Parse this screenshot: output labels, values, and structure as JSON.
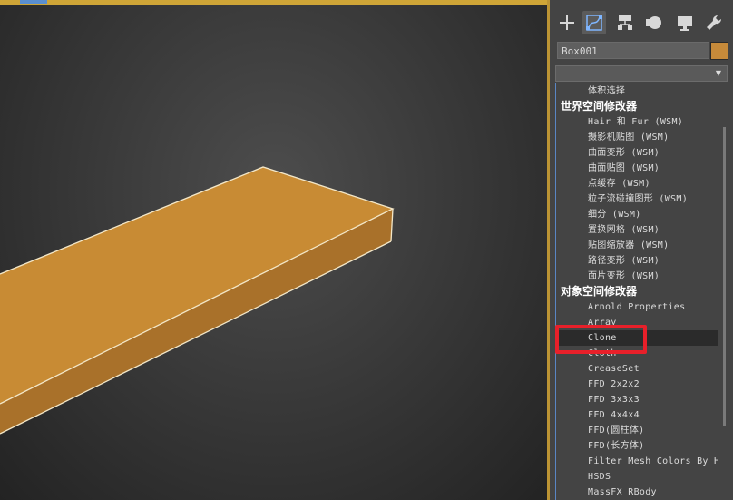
{
  "object_name": "Box001",
  "object_color": "#c68a3a",
  "modifier_dropdown_value": "",
  "command_tabs": [
    {
      "name": "create",
      "icon": "plus-icon"
    },
    {
      "name": "modify",
      "icon": "modify-curve-icon",
      "active": true
    },
    {
      "name": "hierarchy",
      "icon": "hierarchy-icon"
    },
    {
      "name": "motion",
      "icon": "motion-icon"
    },
    {
      "name": "display",
      "icon": "display-monitor-icon"
    },
    {
      "name": "utilities",
      "icon": "wrench-icon"
    }
  ],
  "modifier_list": {
    "rows": [
      {
        "type": "item",
        "label": "体积选择"
      },
      {
        "type": "header",
        "label": "世界空间修改器"
      },
      {
        "type": "item",
        "label": "Hair 和 Fur (WSM)"
      },
      {
        "type": "item",
        "label": "摄影机贴图 (WSM)"
      },
      {
        "type": "item",
        "label": "曲面变形 (WSM)"
      },
      {
        "type": "item",
        "label": "曲面贴图 (WSM)"
      },
      {
        "type": "item",
        "label": "点缓存 (WSM)"
      },
      {
        "type": "item",
        "label": "粒子流碰撞图形 (WSM)"
      },
      {
        "type": "item",
        "label": "细分 (WSM)"
      },
      {
        "type": "item",
        "label": "置换网格 (WSM)"
      },
      {
        "type": "item",
        "label": "贴图缩放器 (WSM)"
      },
      {
        "type": "item",
        "label": "路径变形 (WSM)"
      },
      {
        "type": "item",
        "label": "面片变形 (WSM)"
      },
      {
        "type": "header",
        "label": "对象空间修改器"
      },
      {
        "type": "item",
        "label": "Arnold Properties"
      },
      {
        "type": "item",
        "label": "Array"
      },
      {
        "type": "item",
        "label": "Clone",
        "selected": true
      },
      {
        "type": "item",
        "label": "Cloth"
      },
      {
        "type": "item",
        "label": "CreaseSet"
      },
      {
        "type": "item",
        "label": "FFD 2x2x2"
      },
      {
        "type": "item",
        "label": "FFD 3x3x3"
      },
      {
        "type": "item",
        "label": "FFD 4x4x4"
      },
      {
        "type": "item",
        "label": "FFD(圆柱体)"
      },
      {
        "type": "item",
        "label": "FFD(长方体)"
      },
      {
        "type": "item",
        "label": "Filter Mesh Colors By H"
      },
      {
        "type": "item",
        "label": "HSDS"
      },
      {
        "type": "item",
        "label": "MassFX RBody"
      }
    ]
  },
  "highlight_color": "#e8202a"
}
